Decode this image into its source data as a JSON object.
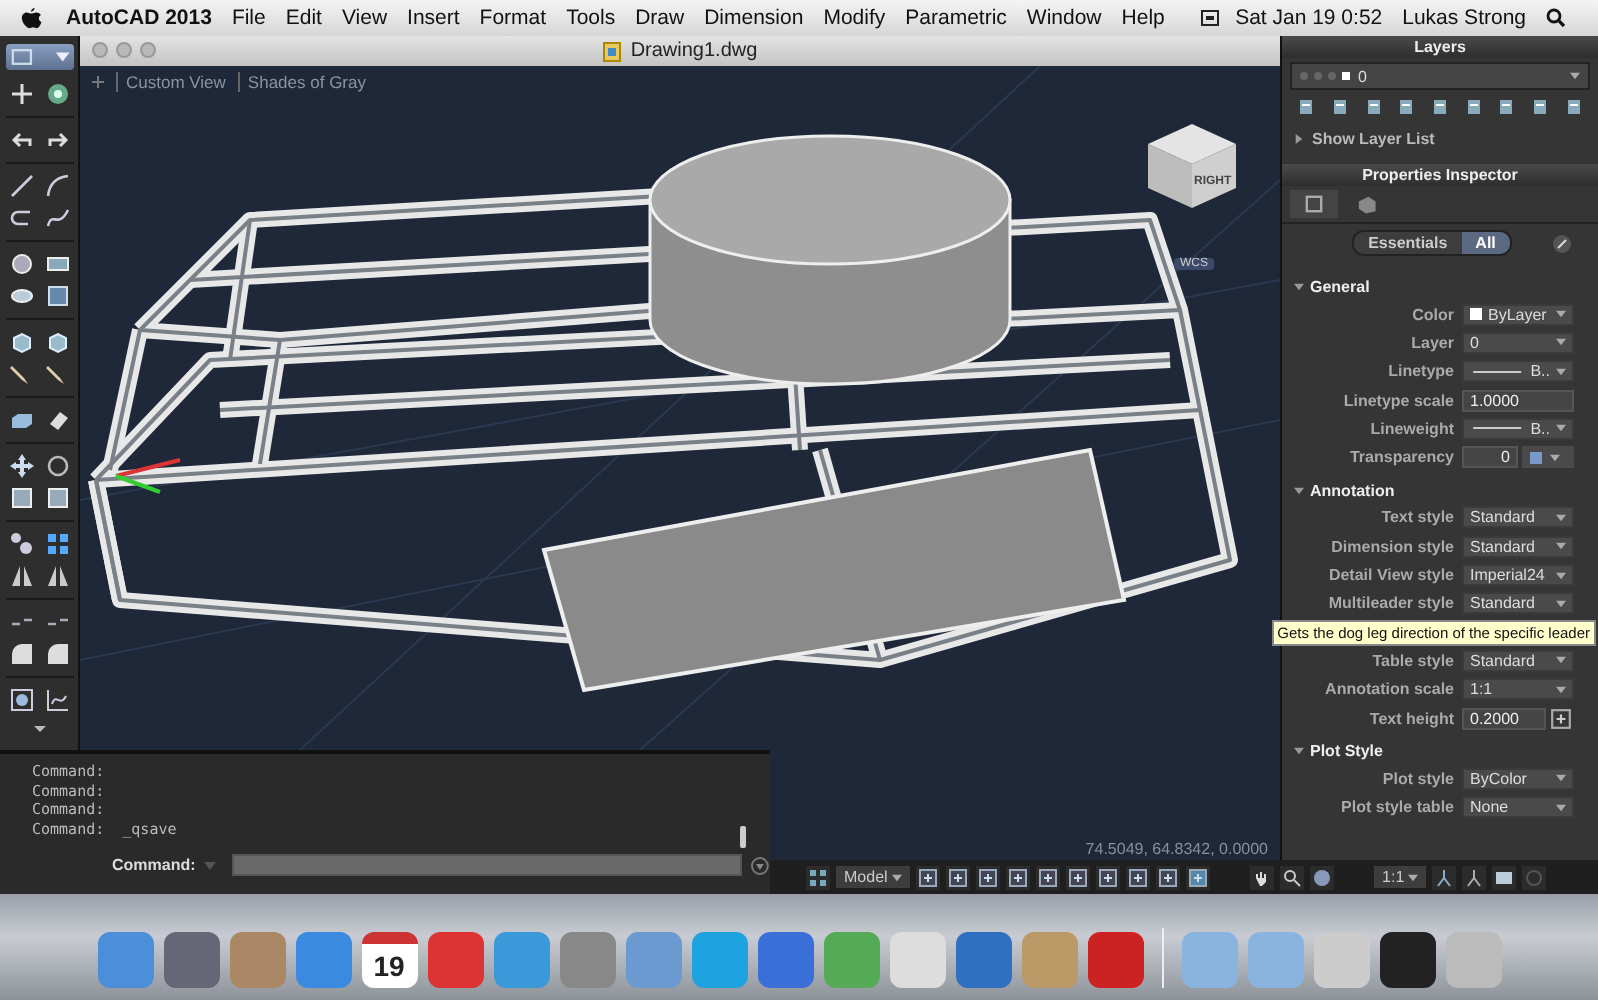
{
  "menu_bar": {
    "app_name": "AutoCAD 2013",
    "items": [
      "File",
      "Edit",
      "View",
      "Insert",
      "Format",
      "Tools",
      "Draw",
      "Dimension",
      "Modify",
      "Parametric",
      "Window",
      "Help"
    ],
    "clock": "Sat Jan 19  0:52",
    "user": "Lukas Strong"
  },
  "document_window": {
    "title": "Drawing1.dwg",
    "view_labels": [
      "Custom View",
      "Shades of Gray"
    ],
    "view_cube_face": "RIGHT",
    "ucs_label": "WCS",
    "coordinates": "74.5049, 64.8342, 0.0000"
  },
  "command_line": {
    "history": [
      "Command:",
      "Command:",
      "Command:",
      "Command:  _qsave"
    ],
    "prompt": "Command:"
  },
  "status_bar": {
    "layout": "Model",
    "annotation_scale": "1:1"
  },
  "layers_panel": {
    "title": "Layers",
    "current_layer": "0",
    "show_layer_list": "Show Layer List"
  },
  "properties_inspector": {
    "title": "Properties Inspector",
    "tabs": [
      {
        "label": "Essentials",
        "selected": false
      },
      {
        "label": "All",
        "selected": true
      }
    ],
    "sections": [
      {
        "title": "General",
        "expanded": true,
        "rows": [
          {
            "label": "Color",
            "value": "ByLayer",
            "kind": "color"
          },
          {
            "label": "Layer",
            "value": "0",
            "kind": "dropdown"
          },
          {
            "label": "Linetype",
            "value": "B..",
            "kind": "linetype"
          },
          {
            "label": "Linetype scale",
            "value": "1.0000",
            "kind": "field"
          },
          {
            "label": "Lineweight",
            "value": "B..",
            "kind": "linetype"
          },
          {
            "label": "Transparency",
            "value": "0",
            "kind": "transparency"
          }
        ]
      },
      {
        "title": "Annotation",
        "expanded": true,
        "rows": [
          {
            "label": "Text style",
            "value": "Standard",
            "kind": "dropdown"
          },
          {
            "label": "Dimension style",
            "value": "Standard",
            "kind": "dropdown"
          },
          {
            "label": "Detail View style",
            "value": "Imperial24",
            "kind": "dropdown"
          },
          {
            "label": "Multileader style",
            "value": "Standard",
            "kind": "dropdown"
          },
          {
            "kind": "covered"
          },
          {
            "label": "Table style",
            "value": "Standard",
            "kind": "dropdown"
          },
          {
            "label": "Annotation scale",
            "value": "1:1",
            "kind": "dropdown"
          },
          {
            "label": "Text height",
            "value": "0.2000",
            "kind": "field_button"
          }
        ]
      },
      {
        "title": "Plot Style",
        "expanded": true,
        "rows": [
          {
            "label": "Plot style",
            "value": "ByColor",
            "kind": "dropdown"
          },
          {
            "label": "Plot style table",
            "value": "None",
            "kind": "dropdown"
          }
        ]
      }
    ]
  },
  "tooltip": "Gets the dog leg direction of the specific leader",
  "dock": {
    "calendar_day": "19"
  }
}
